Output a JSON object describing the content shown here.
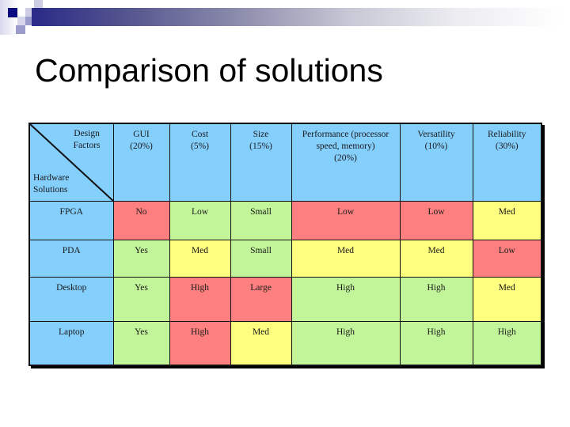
{
  "slide": {
    "title": "Comparison of solutions"
  },
  "colors": {
    "header_bg": "#85cffd",
    "bad": "#fd7f7f",
    "good": "#c2f49a",
    "medium": "#fefe7f",
    "title_bar_start": "#2a2a88"
  },
  "table": {
    "corner": {
      "design_factors": "Design\nFactors",
      "hardware_solutions": "Hardware\nSolutions"
    },
    "columns": [
      {
        "label": "GUI\n(20%)"
      },
      {
        "label": "Cost\n(5%)"
      },
      {
        "label": "Size\n(15%)"
      },
      {
        "label": "Performance (processor\n speed, memory)\n(20%)"
      },
      {
        "label": "Versatility\n(10%)"
      },
      {
        "label": "Reliability\n(30%)"
      }
    ],
    "rows": [
      {
        "label": "FPGA",
        "cells": [
          {
            "value": "No",
            "rating": "bad"
          },
          {
            "value": "Low",
            "rating": "good"
          },
          {
            "value": "Small",
            "rating": "good"
          },
          {
            "value": "Low",
            "rating": "bad"
          },
          {
            "value": "Low",
            "rating": "bad"
          },
          {
            "value": "Med",
            "rating": "medium"
          }
        ]
      },
      {
        "label": "PDA",
        "cells": [
          {
            "value": "Yes",
            "rating": "good"
          },
          {
            "value": "Med",
            "rating": "medium"
          },
          {
            "value": "Small",
            "rating": "good"
          },
          {
            "value": "Med",
            "rating": "medium"
          },
          {
            "value": "Med",
            "rating": "medium"
          },
          {
            "value": "Low",
            "rating": "bad"
          }
        ]
      },
      {
        "label": "Desktop",
        "cells": [
          {
            "value": "Yes",
            "rating": "good"
          },
          {
            "value": "High",
            "rating": "bad"
          },
          {
            "value": "Large",
            "rating": "bad"
          },
          {
            "value": "High",
            "rating": "good"
          },
          {
            "value": "High",
            "rating": "good"
          },
          {
            "value": "Med",
            "rating": "medium"
          }
        ]
      },
      {
        "label": "Laptop",
        "cells": [
          {
            "value": "Yes",
            "rating": "good"
          },
          {
            "value": "High",
            "rating": "bad"
          },
          {
            "value": "Med",
            "rating": "medium"
          },
          {
            "value": "High",
            "rating": "good"
          },
          {
            "value": "High",
            "rating": "good"
          },
          {
            "value": "High",
            "rating": "good"
          }
        ]
      }
    ]
  }
}
